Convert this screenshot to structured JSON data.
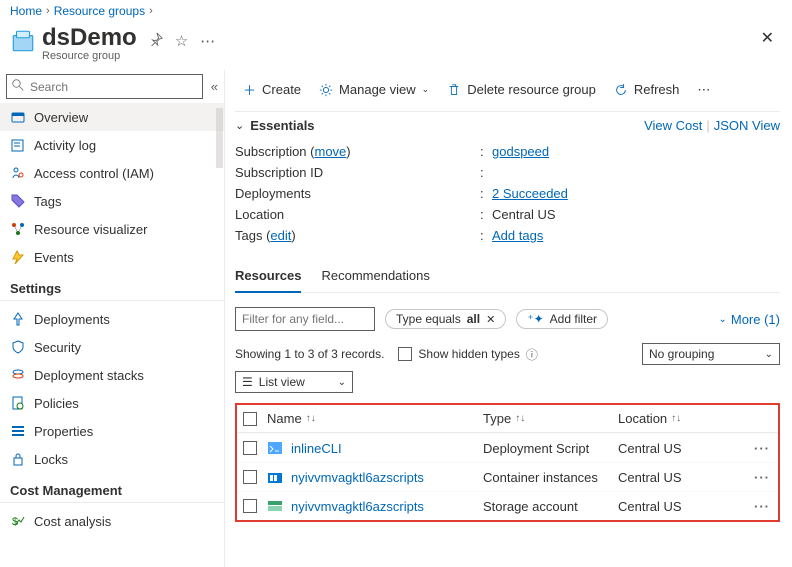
{
  "breadcrumb": {
    "home": "Home",
    "group": "Resource groups"
  },
  "header": {
    "title": "dsDemo",
    "subtitle": "Resource group"
  },
  "search": {
    "placeholder": "Search"
  },
  "sidebar": {
    "items": [
      {
        "label": "Overview"
      },
      {
        "label": "Activity log"
      },
      {
        "label": "Access control (IAM)"
      },
      {
        "label": "Tags"
      },
      {
        "label": "Resource visualizer"
      },
      {
        "label": "Events"
      }
    ],
    "settingsHead": "Settings",
    "settings": [
      {
        "label": "Deployments"
      },
      {
        "label": "Security"
      },
      {
        "label": "Deployment stacks"
      },
      {
        "label": "Policies"
      },
      {
        "label": "Properties"
      },
      {
        "label": "Locks"
      }
    ],
    "costHead": "Cost Management",
    "cost": [
      {
        "label": "Cost analysis"
      }
    ]
  },
  "commands": {
    "create": "Create",
    "manageView": "Manage view",
    "delete": "Delete resource group",
    "refresh": "Refresh"
  },
  "essentials": {
    "title": "Essentials",
    "viewCost": "View Cost",
    "jsonView": "JSON View",
    "rows": {
      "subscriptionLabel": "Subscription",
      "subscriptionMove": "move",
      "subscriptionValue": "godspeed",
      "subIdLabel": "Subscription ID",
      "subIdValue": "",
      "deploymentsLabel": "Deployments",
      "deploymentsValue": "2 Succeeded",
      "locationLabel": "Location",
      "locationValue": "Central US",
      "tagsLabel": "Tags",
      "tagsEdit": "edit",
      "tagsValue": "Add tags"
    }
  },
  "tabs": {
    "resources": "Resources",
    "recommendations": "Recommendations"
  },
  "filters": {
    "placeholder": "Filter for any field...",
    "typePill": "Type equals",
    "typePillBold": "all",
    "addFilter": "Add filter",
    "more": "More (1)"
  },
  "meta": {
    "showing": "Showing 1 to 3 of 3 records.",
    "hidden": "Show hidden types",
    "grouping": "No grouping",
    "listView": "List view"
  },
  "table": {
    "headers": {
      "name": "Name",
      "type": "Type",
      "location": "Location"
    },
    "rows": [
      {
        "name": "inlineCLI",
        "type": "Deployment Script",
        "location": "Central US",
        "icon": "script"
      },
      {
        "name": "nyivvmvagktl6azscripts",
        "type": "Container instances",
        "location": "Central US",
        "icon": "container"
      },
      {
        "name": "nyivvmvagktl6azscripts",
        "type": "Storage account",
        "location": "Central US",
        "icon": "storage"
      }
    ]
  }
}
